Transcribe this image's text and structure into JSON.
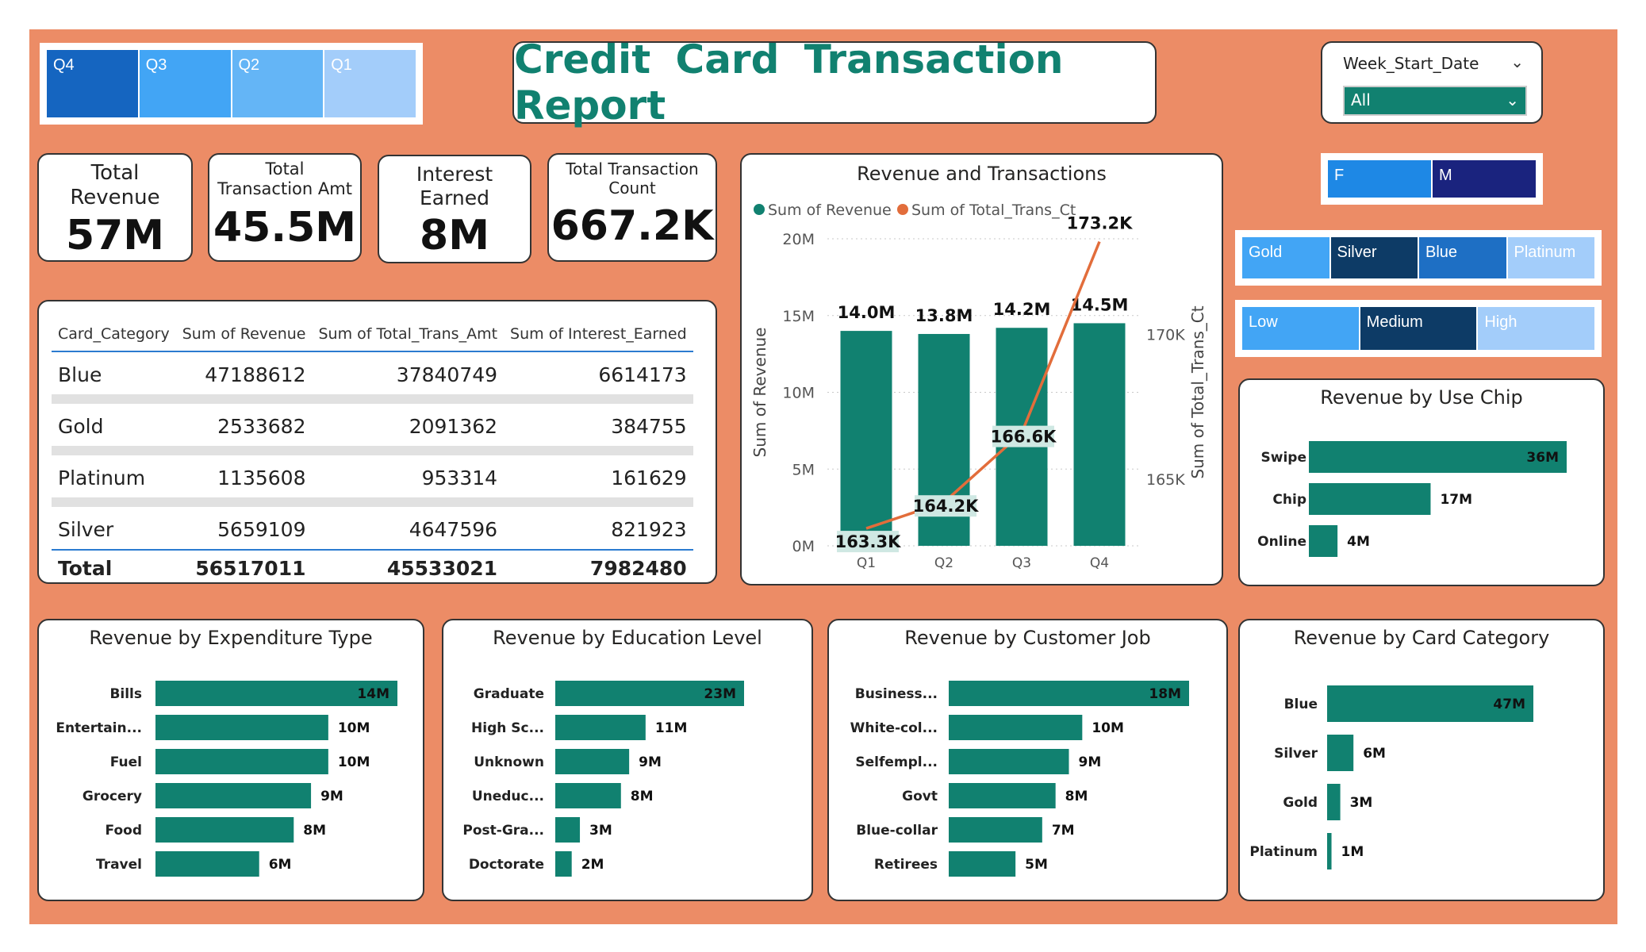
{
  "header": {
    "title": "Credit  Card  Transaction  Report"
  },
  "quarter_slicer": [
    {
      "label": "Q4",
      "color": "#1565c0"
    },
    {
      "label": "Q3",
      "color": "#42a5f5"
    },
    {
      "label": "Q2",
      "color": "#64b5f6"
    },
    {
      "label": "Q1",
      "color": "#a3cdfa"
    }
  ],
  "week_filter": {
    "label": "Week_Start_Date",
    "value": "All"
  },
  "gender_slicer": [
    {
      "label": "F",
      "color": "#1e88e5"
    },
    {
      "label": "M",
      "color": "#1a237e"
    }
  ],
  "card_slicer": [
    {
      "label": "Gold",
      "color": "#42a5f5"
    },
    {
      "label": "Silver",
      "color": "#0d3b66"
    },
    {
      "label": "Blue",
      "color": "#1e6fc4"
    },
    {
      "label": "Platinum",
      "color": "#a3cdfa"
    }
  ],
  "income_slicer": [
    {
      "label": "Low",
      "color": "#42a5f5"
    },
    {
      "label": "Medium",
      "color": "#0d3b66"
    },
    {
      "label": "High",
      "color": "#a3cdfa"
    }
  ],
  "kpis": [
    {
      "label": "Total Revenue",
      "value": "57M"
    },
    {
      "label": "Total Transaction Amt",
      "value": "45.5M"
    },
    {
      "label": "Interest Earned",
      "value": "8M"
    },
    {
      "label": "Total Transaction Count",
      "value": "667.2K"
    }
  ],
  "table": {
    "columns": [
      "Card_Category",
      "Sum of Revenue",
      "Sum of Total_Trans_Amt",
      "Sum of Interest_Earned"
    ],
    "rows": [
      [
        "Blue",
        "47188612",
        "37840749",
        "6614173"
      ],
      [
        "Gold",
        "2533682",
        "2091362",
        "384755"
      ],
      [
        "Platinum",
        "1135608",
        "953314",
        "161629"
      ],
      [
        "Silver",
        "5659109",
        "4647596",
        "821923"
      ]
    ],
    "total": [
      "Total",
      "56517011",
      "45533021",
      "7982480"
    ]
  },
  "colors": {
    "bar": "#118170",
    "line": "#e26d3b",
    "background": "#ec8c66",
    "title": "#118170"
  },
  "chart_data": [
    {
      "id": "revenue_transactions",
      "type": "bar",
      "title": "Revenue and Transactions",
      "categories": [
        "Q1",
        "Q2",
        "Q3",
        "Q4"
      ],
      "series": [
        {
          "name": "Sum of Revenue",
          "type": "bar",
          "axis": "left",
          "values": [
            14.0,
            13.8,
            14.2,
            14.5
          ],
          "labels": [
            "14.0M",
            "13.8M",
            "14.2M",
            "14.5M"
          ]
        },
        {
          "name": "Sum of Total_Trans_Ct",
          "type": "line",
          "axis": "right",
          "values": [
            163.3,
            164.2,
            166.6,
            173.2
          ],
          "labels": [
            "163.3K",
            "164.2K",
            "166.6K",
            "173.2K"
          ]
        }
      ],
      "ylabel": "Sum of Revenue",
      "y2label": "Sum of Total_Trans_Ct",
      "ylim": [
        0,
        20
      ],
      "yticks": [
        "0M",
        "5M",
        "10M",
        "15M",
        "20M"
      ],
      "y2lim": [
        162.7,
        173.3
      ],
      "y2ticks": [
        "165K",
        "170K"
      ],
      "legend": "top-left"
    },
    {
      "id": "use_chip",
      "type": "bar",
      "orientation": "horizontal",
      "title": "Revenue by Use Chip",
      "categories": [
        "Swipe",
        "Chip",
        "Online"
      ],
      "values": [
        36,
        17,
        4
      ],
      "labels": [
        "36M",
        "17M",
        "4M"
      ],
      "xlim": [
        0,
        36
      ]
    },
    {
      "id": "expenditure",
      "type": "bar",
      "orientation": "horizontal",
      "title": "Revenue by Expenditure Type",
      "categories": [
        "Bills",
        "Entertain...",
        "Fuel",
        "Grocery",
        "Food",
        "Travel"
      ],
      "values": [
        14,
        10,
        10,
        9,
        8,
        6
      ],
      "labels": [
        "14M",
        "10M",
        "10M",
        "9M",
        "8M",
        "6M"
      ],
      "xlim": [
        0,
        14
      ]
    },
    {
      "id": "education",
      "type": "bar",
      "orientation": "horizontal",
      "title": "Revenue by Education Level",
      "categories": [
        "Graduate",
        "High Sc...",
        "Unknown",
        "Uneduc...",
        "Post-Gra...",
        "Doctorate"
      ],
      "values": [
        23,
        11,
        9,
        8,
        3,
        2
      ],
      "labels": [
        "23M",
        "11M",
        "9M",
        "8M",
        "3M",
        "2M"
      ],
      "xlim": [
        0,
        23
      ]
    },
    {
      "id": "job",
      "type": "bar",
      "orientation": "horizontal",
      "title": "Revenue by Customer Job",
      "categories": [
        "Business...",
        "White-col...",
        "Selfempl...",
        "Govt",
        "Blue-collar",
        "Retirees"
      ],
      "values": [
        18,
        10,
        9,
        8,
        7,
        5
      ],
      "labels": [
        "18M",
        "10M",
        "9M",
        "8M",
        "7M",
        "5M"
      ],
      "xlim": [
        0,
        18
      ]
    },
    {
      "id": "card_category",
      "type": "bar",
      "orientation": "horizontal",
      "title": "Revenue by Card Category",
      "categories": [
        "Blue",
        "Silver",
        "Gold",
        "Platinum"
      ],
      "values": [
        47,
        6,
        3,
        1
      ],
      "labels": [
        "47M",
        "6M",
        "3M",
        "1M"
      ],
      "xlim": [
        0,
        47
      ]
    }
  ]
}
